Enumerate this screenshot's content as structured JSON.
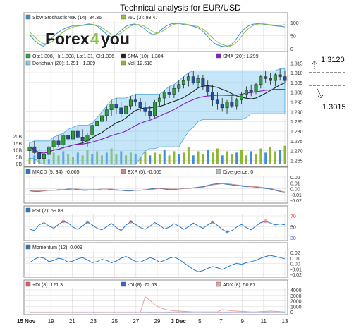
{
  "page_title": "Technical analysis for EUR/USD",
  "brand": {
    "part1": "Forex",
    "part2": "4",
    "part3": "you"
  },
  "colors": {
    "panel_bg": "#ffffff",
    "border": "#8c8c8c",
    "grid": "#d9d9d9",
    "candle_up": "#2e9e3a",
    "candle_down": "#1f4f9e",
    "sma10": "#222222",
    "sma20": "#7f1fbf",
    "donchian": "#7ec8f0",
    "volume": "#8fb82e",
    "volume_alt": "#3c8fe0",
    "macd": "#1e78c8",
    "signal": "#c98989",
    "rsi": "#1e78c8",
    "momentum": "#1e78c8",
    "plus_di": "#ee5555",
    "minus_di": "#3366cc",
    "adx": "#e8a0a0",
    "stoch_k": "#3a8fd0",
    "stoch_d": "#8fc04a",
    "annotation": "#222222"
  },
  "legends": {
    "stochastic": [
      {
        "label": "Slow Stochastic %K (14): 84.36",
        "color": "#3a8fd0"
      },
      {
        "label": "%D (3): 93.47",
        "color": "#8fc04a"
      }
    ],
    "price": [
      {
        "label": "Op:1.308, Hi:1.308, Lo:1.31, Cl:1.306",
        "color": "#2e9e3a"
      },
      {
        "label": "SMA (10): 1.304",
        "color": "#222222"
      },
      {
        "label": "SMA (20): 1.299",
        "color": "#7f1fbf"
      },
      {
        "label": "Donchian (20): 1.291 - 1.309",
        "color": "#7ec8f0"
      },
      {
        "label": "Vol: 12.518",
        "color": "#8fb82e"
      }
    ],
    "macd": [
      {
        "label": "MACD (5, 34): -0.005",
        "color": "#1e78c8"
      },
      {
        "label": "EXP (5): -0.005",
        "color": "#c98989"
      },
      {
        "label": "Divergence: 0",
        "color": "#bbbbbb"
      }
    ],
    "rsi": [
      {
        "label": "RSI (7): 59.88",
        "color": "#1e78c8"
      }
    ],
    "momentum": [
      {
        "label": "Momentum (12): 0.009",
        "color": "#1e78c8"
      }
    ],
    "dmi": [
      {
        "label": "+DI (8): 121.3",
        "color": "#ee5555"
      },
      {
        "label": "-DI (8): 72.63",
        "color": "#3366cc"
      },
      {
        "label": "ADX (8): 50.87",
        "color": "#e8a0a0"
      }
    ]
  },
  "annotations": {
    "resistance": "1.3120",
    "support": "1.3015"
  },
  "x_ticks": [
    "15 Nov",
    "19",
    "21",
    "23",
    "25",
    "27",
    "29",
    "3 Dec",
    "5",
    "7",
    "9",
    "11",
    "13"
  ],
  "chart_data": [
    {
      "id": "stochastic",
      "type": "line",
      "ylim": [
        0,
        100
      ],
      "yticks": [
        "100",
        "50",
        "0"
      ],
      "series": [
        {
          "name": "Slow Stochastic %K (14)",
          "values": [
            55,
            35,
            20,
            12,
            25,
            45,
            60,
            72,
            80,
            86,
            90,
            88,
            92,
            95,
            93,
            85,
            70,
            55,
            45,
            55,
            70,
            85,
            92,
            95,
            90,
            80,
            65,
            55,
            60,
            75,
            88,
            95,
            97,
            96,
            92,
            90,
            86,
            80,
            68,
            50,
            30,
            18,
            12,
            10,
            15,
            30,
            55,
            75,
            88,
            94,
            96,
            95,
            92,
            90,
            88,
            86,
            84
          ]
        },
        {
          "name": "%D (3)",
          "values": [
            65,
            48,
            32,
            22,
            20,
            30,
            45,
            60,
            72,
            80,
            86,
            88,
            90,
            92,
            93,
            90,
            80,
            68,
            55,
            52,
            60,
            74,
            86,
            92,
            93,
            88,
            78,
            66,
            60,
            66,
            78,
            89,
            95,
            96,
            95,
            92,
            89,
            85,
            76,
            62,
            45,
            30,
            20,
            14,
            12,
            20,
            38,
            60,
            78,
            89,
            94,
            96,
            94,
            92,
            90,
            88,
            93
          ]
        }
      ]
    },
    {
      "id": "price",
      "type": "candlestick",
      "ylim": [
        1.263,
        1.318
      ],
      "yticks": [
        "1.315",
        "1.310",
        "1.305",
        "1.300",
        "1.295",
        "1.290",
        "1.285",
        "1.280",
        "1.275",
        "1.270",
        "1.265"
      ],
      "ohlc": [
        [
          1.27,
          1.274,
          1.266,
          1.272
        ],
        [
          1.272,
          1.275,
          1.268,
          1.269
        ],
        [
          1.269,
          1.272,
          1.264,
          1.266
        ],
        [
          1.266,
          1.27,
          1.263,
          1.268
        ],
        [
          1.268,
          1.273,
          1.266,
          1.272
        ],
        [
          1.272,
          1.277,
          1.27,
          1.275
        ],
        [
          1.275,
          1.278,
          1.272,
          1.273
        ],
        [
          1.273,
          1.279,
          1.271,
          1.278
        ],
        [
          1.278,
          1.281,
          1.274,
          1.276
        ],
        [
          1.276,
          1.282,
          1.274,
          1.28
        ],
        [
          1.28,
          1.283,
          1.276,
          1.277
        ],
        [
          1.277,
          1.281,
          1.273,
          1.275
        ],
        [
          1.275,
          1.279,
          1.272,
          1.278
        ],
        [
          1.278,
          1.284,
          1.276,
          1.283
        ],
        [
          1.283,
          1.287,
          1.28,
          1.285
        ],
        [
          1.285,
          1.29,
          1.282,
          1.288
        ],
        [
          1.288,
          1.293,
          1.285,
          1.291
        ],
        [
          1.291,
          1.296,
          1.288,
          1.294
        ],
        [
          1.294,
          1.297,
          1.289,
          1.292
        ],
        [
          1.292,
          1.295,
          1.287,
          1.289
        ],
        [
          1.289,
          1.294,
          1.286,
          1.293
        ],
        [
          1.293,
          1.298,
          1.291,
          1.296
        ],
        [
          1.296,
          1.299,
          1.293,
          1.295
        ],
        [
          1.295,
          1.297,
          1.29,
          1.292
        ],
        [
          1.292,
          1.295,
          1.288,
          1.29
        ],
        [
          1.29,
          1.293,
          1.286,
          1.288
        ],
        [
          1.288,
          1.296,
          1.287,
          1.295
        ],
        [
          1.295,
          1.299,
          1.293,
          1.297
        ],
        [
          1.297,
          1.301,
          1.294,
          1.3
        ],
        [
          1.3,
          1.303,
          1.297,
          1.299
        ],
        [
          1.299,
          1.304,
          1.297,
          1.302
        ],
        [
          1.302,
          1.306,
          1.3,
          1.304
        ],
        [
          1.304,
          1.308,
          1.302,
          1.306
        ],
        [
          1.306,
          1.31,
          1.303,
          1.308
        ],
        [
          1.308,
          1.311,
          1.304,
          1.305
        ],
        [
          1.305,
          1.309,
          1.302,
          1.307
        ],
        [
          1.307,
          1.309,
          1.301,
          1.303
        ],
        [
          1.303,
          1.306,
          1.298,
          1.3
        ],
        [
          1.3,
          1.304,
          1.293,
          1.296
        ],
        [
          1.296,
          1.3,
          1.291,
          1.294
        ],
        [
          1.294,
          1.297,
          1.29,
          1.292
        ],
        [
          1.292,
          1.296,
          1.289,
          1.295
        ],
        [
          1.295,
          1.298,
          1.292,
          1.293
        ],
        [
          1.293,
          1.297,
          1.291,
          1.296
        ],
        [
          1.296,
          1.3,
          1.294,
          1.299
        ],
        [
          1.299,
          1.303,
          1.297,
          1.301
        ],
        [
          1.301,
          1.304,
          1.298,
          1.3
        ],
        [
          1.3,
          1.305,
          1.299,
          1.304
        ],
        [
          1.304,
          1.309,
          1.302,
          1.308
        ],
        [
          1.308,
          1.311,
          1.305,
          1.307
        ],
        [
          1.307,
          1.31,
          1.304,
          1.306
        ],
        [
          1.306,
          1.31,
          1.303,
          1.309
        ],
        [
          1.309,
          1.312,
          1.306,
          1.308
        ],
        [
          1.308,
          1.311,
          1.305,
          1.306
        ]
      ],
      "volume_ticks": [
        "20B",
        "15B",
        "10B",
        "5B",
        "0B"
      ],
      "volume_ylim": [
        0,
        20
      ],
      "volume": [
        4,
        6,
        5,
        7,
        3,
        8,
        6,
        9,
        7,
        5,
        8,
        6,
        10,
        7,
        9,
        6,
        8,
        11,
        7,
        9,
        6,
        8,
        7,
        5,
        9,
        6,
        8,
        7,
        10,
        6,
        9,
        7,
        8,
        12,
        6,
        9,
        7,
        10,
        8,
        11,
        6,
        9,
        7,
        8,
        10,
        6,
        9,
        7,
        11,
        8,
        12,
        9,
        10,
        13
      ]
    },
    {
      "id": "macd",
      "type": "line",
      "ylim": [
        -0.02,
        0.02
      ],
      "yticks": [
        "0.02",
        "0.01",
        "0.00",
        "-0.01",
        "-0.02"
      ],
      "series": [
        {
          "name": "MACD (5, 34)",
          "values": [
            -0.003,
            -0.004,
            -0.004,
            -0.003,
            -0.002,
            -0.002,
            -0.001,
            -0.001,
            0.0,
            0.0,
            -0.001,
            -0.002,
            -0.002,
            -0.001,
            -0.001,
            0.0,
            0.0,
            -0.001,
            -0.002,
            -0.002,
            -0.003,
            -0.003,
            -0.002,
            -0.002,
            -0.001,
            0.0,
            0.001,
            0.001,
            0.0,
            -0.001,
            -0.001,
            0.0,
            0.001,
            0.001,
            0.002,
            0.003,
            0.004,
            0.006,
            0.008,
            0.009,
            0.009,
            0.008,
            0.007,
            0.006,
            0.005,
            0.004,
            0.004,
            0.003,
            0.002,
            0.001,
            0.0,
            -0.002,
            -0.004,
            -0.005
          ]
        },
        {
          "name": "EXP (5)",
          "values": [
            -0.002,
            -0.003,
            -0.003,
            -0.003,
            -0.002,
            -0.002,
            -0.002,
            -0.001,
            -0.001,
            0.0,
            0.0,
            -0.001,
            -0.001,
            -0.001,
            -0.001,
            0.0,
            0.0,
            0.0,
            -0.001,
            -0.002,
            -0.002,
            -0.002,
            -0.002,
            -0.002,
            -0.001,
            -0.001,
            0.0,
            0.001,
            0.001,
            0.0,
            0.0,
            0.0,
            0.001,
            0.001,
            0.002,
            0.002,
            0.003,
            0.005,
            0.007,
            0.008,
            0.009,
            0.009,
            0.008,
            0.007,
            0.006,
            0.005,
            0.004,
            0.004,
            0.003,
            0.002,
            0.001,
            -0.001,
            -0.003,
            -0.005
          ]
        }
      ]
    },
    {
      "id": "rsi",
      "type": "line",
      "ylim": [
        0,
        100
      ],
      "yticks": [
        "70",
        "50",
        "30"
      ],
      "series": [
        {
          "name": "RSI (7)",
          "values": [
            40,
            35,
            60,
            70,
            55,
            45,
            62,
            75,
            68,
            50,
            40,
            55,
            72,
            60,
            45,
            38,
            52,
            66,
            48,
            35,
            58,
            74,
            62,
            48,
            40,
            55,
            70,
            58,
            42,
            50,
            65,
            55,
            40,
            52,
            68,
            55,
            45,
            60,
            72,
            58,
            40,
            28,
            35,
            50,
            62,
            48,
            38,
            55,
            70,
            76,
            68,
            60,
            64,
            60
          ]
        }
      ]
    },
    {
      "id": "momentum",
      "type": "line",
      "ylim": [
        -0.02,
        0.02
      ],
      "yticks": [
        "0.02",
        "0.01",
        "0.00",
        "-0.01",
        "-0.02"
      ],
      "series": [
        {
          "name": "Momentum (12)",
          "values": [
            0.002,
            0.008,
            0.012,
            0.01,
            0.004,
            0.006,
            0.01,
            0.008,
            0.003,
            0.005,
            0.009,
            0.011,
            0.007,
            0.002,
            0.004,
            0.008,
            0.006,
            0.002,
            0.005,
            0.01,
            0.013,
            0.009,
            0.004,
            0.003,
            0.007,
            0.011,
            0.008,
            0.003,
            0.006,
            0.01,
            0.012,
            0.008,
            0.002,
            -0.004,
            -0.01,
            -0.014,
            -0.012,
            -0.008,
            -0.005,
            -0.007,
            -0.01,
            -0.006,
            -0.002,
            0.001,
            -0.001,
            0.002,
            0.004,
            0.006,
            0.01,
            0.013,
            0.015,
            0.013,
            0.011,
            0.009
          ]
        }
      ]
    },
    {
      "id": "dmi",
      "type": "line",
      "ylim": [
        0,
        4000
      ],
      "yticks": [
        "4000",
        "3000",
        "2000",
        "1000",
        "0"
      ],
      "series": [
        {
          "name": "+DI (8)",
          "values": [
            10,
            20,
            15,
            25,
            20,
            30,
            15,
            20,
            25,
            20,
            15,
            20,
            30,
            25,
            20,
            15,
            20,
            25,
            20,
            15,
            20,
            25,
            20,
            15,
            20,
            25,
            30,
            20,
            15,
            20,
            25,
            20,
            15,
            20,
            25,
            20,
            30,
            25,
            20,
            15,
            20,
            25,
            30,
            20,
            25,
            20,
            30,
            25,
            20,
            25,
            20,
            30,
            25,
            20
          ]
        },
        {
          "name": "-DI (8)",
          "values": [
            15,
            25,
            20,
            15,
            25,
            20,
            25,
            15,
            20,
            25,
            20,
            15,
            20,
            25,
            15,
            20,
            25,
            20,
            15,
            25,
            20,
            15,
            20,
            25,
            20,
            15,
            20,
            25,
            20,
            15,
            20,
            25,
            20,
            15,
            20,
            25,
            20,
            15,
            20,
            25,
            20,
            15,
            20,
            25,
            20,
            15,
            20,
            25,
            20,
            15,
            20,
            25,
            20,
            15
          ]
        },
        {
          "name": "ADX (8)",
          "values": [
            30,
            30,
            30,
            30,
            30,
            30,
            30,
            30,
            30,
            30,
            30,
            30,
            30,
            30,
            30,
            30,
            30,
            30,
            30,
            30,
            30,
            30,
            30,
            30,
            2800,
            2100,
            1400,
            900,
            600,
            400,
            300,
            250,
            200,
            150,
            100,
            100,
            100,
            100,
            100,
            100,
            500,
            400,
            300,
            250,
            200,
            150,
            100,
            100,
            150,
            200,
            250,
            200,
            150,
            100
          ]
        }
      ]
    }
  ]
}
